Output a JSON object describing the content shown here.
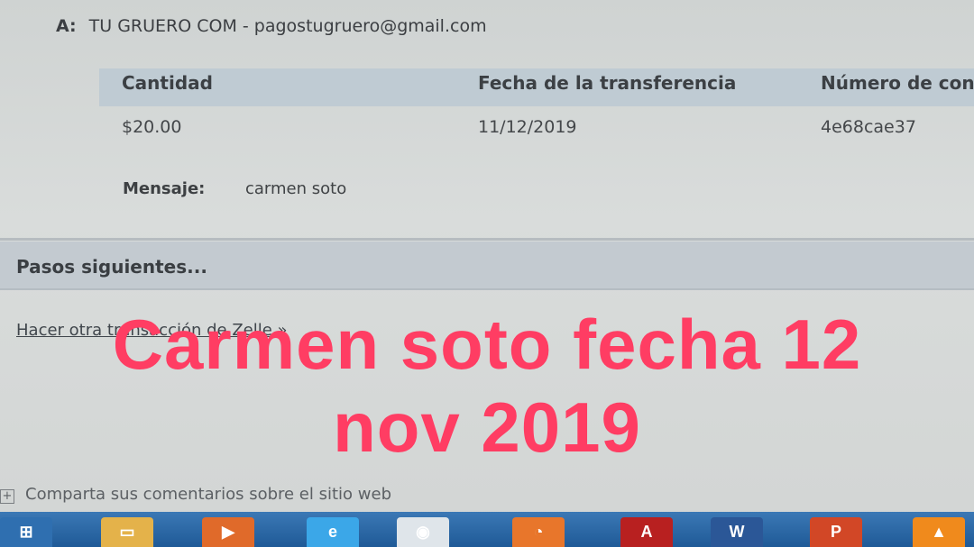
{
  "recipient": {
    "label": "A:",
    "value": "TU GRUERO COM - pagostugruero@gmail.com"
  },
  "transfer_table": {
    "headers": [
      "Cantidad",
      "Fecha de la transferencia",
      "Número de conf"
    ],
    "row": [
      "$20.00",
      "11/12/2019",
      "4e68cae37"
    ]
  },
  "message": {
    "label": "Mensaje:",
    "value": "carmen soto"
  },
  "next_steps": {
    "title": "Pasos siguientes...",
    "link": "Hacer otra transacción de Zelle »"
  },
  "feedback": {
    "icon": "+",
    "text": "Comparta sus comentarios sobre el sitio web"
  },
  "overlay_text": {
    "line1": "Carmen soto fecha 12",
    "line2": "nov 2019"
  },
  "taskbar": {
    "icons": [
      {
        "name": "windows-start-icon",
        "color": "#2f6fb0",
        "glyph": "⊞"
      },
      {
        "name": "folder-icon",
        "color": "#e4b24a",
        "glyph": "▭"
      },
      {
        "name": "media-player-icon",
        "color": "#e06a2a",
        "glyph": "▶"
      },
      {
        "name": "internet-explorer-icon",
        "color": "#3ba7e8",
        "glyph": "e"
      },
      {
        "name": "chrome-icon",
        "color": "#dfe5ea",
        "glyph": "◉"
      },
      {
        "name": "firefox-icon",
        "color": "#e8762b",
        "glyph": "◔"
      },
      {
        "name": "acrobat-icon",
        "color": "#b82020",
        "glyph": "A"
      },
      {
        "name": "word-icon",
        "color": "#2b5797",
        "glyph": "W"
      },
      {
        "name": "powerpoint-icon",
        "color": "#d24726",
        "glyph": "P"
      },
      {
        "name": "vlc-icon",
        "color": "#f08a1c",
        "glyph": "▲"
      }
    ]
  }
}
